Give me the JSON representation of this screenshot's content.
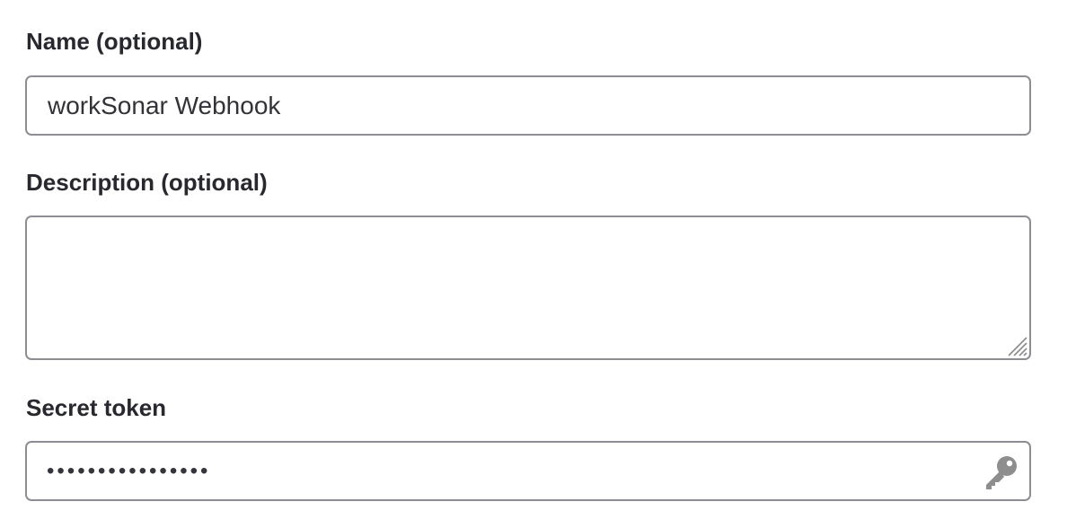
{
  "form": {
    "name": {
      "label": "Name (optional)",
      "value": "workSonar Webhook"
    },
    "description": {
      "label": "Description (optional)",
      "value": ""
    },
    "secret_token": {
      "label": "Secret token",
      "masked_value": "••••••••••••••••",
      "icon": "key-icon"
    }
  },
  "colors": {
    "label_text": "#28282f",
    "border": "#8d8d94",
    "icon": "#8e8e8e"
  }
}
